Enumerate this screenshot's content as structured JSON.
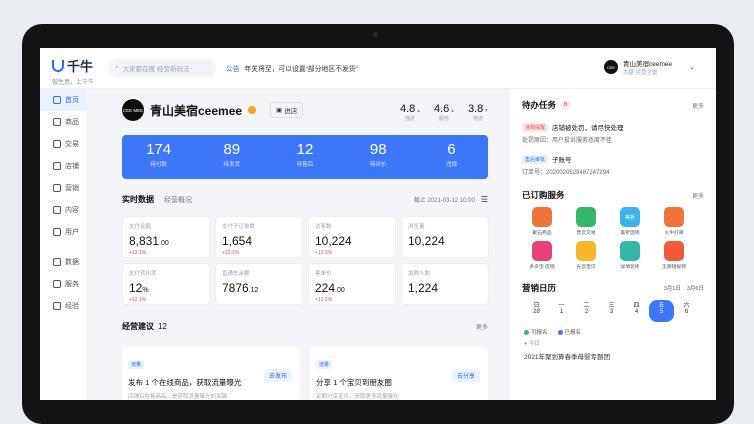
{
  "brand": {
    "name": "千牛",
    "slogan": "做生意，上千牛"
  },
  "search": {
    "placeholder": "大家都在搜  经营新玩法"
  },
  "notice": {
    "tag": "公告",
    "text": "年关将至，可以设置“部分地区不发货”"
  },
  "user": {
    "name": "青山美宿ceemee",
    "role": "大盘  运营主管",
    "avatar_text": "CEE"
  },
  "sidebar": {
    "items": [
      {
        "label": "首页",
        "active": true
      },
      {
        "label": "商品"
      },
      {
        "label": "交易"
      },
      {
        "label": "店铺"
      },
      {
        "label": "营销"
      },
      {
        "label": "内容"
      },
      {
        "label": "用户"
      },
      {
        "label": "数据"
      },
      {
        "label": "服务"
      },
      {
        "label": "经验"
      }
    ]
  },
  "shop": {
    "name": "青山美宿ceemee",
    "enter_label": "进店",
    "avatar_text": "CEE MEE"
  },
  "ratings": [
    {
      "value": "4.8",
      "label": "描述"
    },
    {
      "value": "4.6",
      "label": "服务"
    },
    {
      "value": "3.8",
      "label": "物流"
    }
  ],
  "banner": [
    {
      "value": "174",
      "label": "待付款"
    },
    {
      "value": "89",
      "label": "待发货"
    },
    {
      "value": "12",
      "label": "待售后"
    },
    {
      "value": "98",
      "label": "待评价"
    },
    {
      "value": "6",
      "label": "违规"
    }
  ],
  "realtime": {
    "title": "实时数据",
    "tab": "经营概况",
    "update": "截止 2021-03-12 10:00"
  },
  "cards": [
    {
      "label": "支付金额",
      "value": "8,831",
      "decimals": ".00",
      "change": "+12.1%"
    },
    {
      "label": "支付子订单数",
      "value": "1,654",
      "decimals": "",
      "change": "+12.1%"
    },
    {
      "label": "访客数",
      "value": "10,224",
      "decimals": "",
      "change": "+12.1%"
    },
    {
      "label": "浏览量",
      "value": "10,224",
      "decimals": "",
      "change": ""
    },
    {
      "label": "支付转化率",
      "value": "12",
      "decimals": "%",
      "change": "+12.1%"
    },
    {
      "label": "直通车余额",
      "value": "7876",
      "decimals": ".12",
      "change": ""
    },
    {
      "label": "客单价",
      "value": "224",
      "decimals": ".00",
      "change": "+12.1%"
    },
    {
      "label": "加购人数",
      "value": "1,224",
      "decimals": "",
      "change": ""
    }
  ],
  "suggestions": {
    "title": "经营建议",
    "count": "12",
    "more": "更多",
    "items": [
      {
        "tag": "流量",
        "text": "发布 1 个在线商品，获取流量曝光",
        "desc": "店铺有在售商品，是获取流量曝光的关键",
        "button": "去发布"
      },
      {
        "tag": "流量",
        "text": "分享 1 个宝贝到朋友圈",
        "desc": "定期分享宝贝，获取更多流量曝光",
        "button": "去分享"
      }
    ]
  },
  "tasks": {
    "title": "待办任务",
    "badge": "6",
    "more": "更多",
    "items": [
      {
        "tag": "违规提醒",
        "tag_color": "red",
        "title": "店铺被处罚，请尽快处理",
        "sub": "处罚原因：用户投诉服务态度不佳"
      },
      {
        "tag": "售后审批",
        "tag_color": "blue",
        "title": "子账号",
        "sub": "订单号：2020020529487247294"
      }
    ]
  },
  "services": {
    "title": "已订购服务",
    "more": "更多",
    "items": [
      {
        "label": "聚石商品",
        "color": "#f0733a"
      },
      {
        "label": "普云交易",
        "color": "#33b86b"
      },
      {
        "label": "美折促销",
        "color": "#3cb3e6",
        "text": "美折"
      },
      {
        "label": "火牛打单",
        "color": "#f0733a"
      },
      {
        "label": "多多宝 促销",
        "color": "#e8407a"
      },
      {
        "label": "光云宝贝",
        "color": "#f7b72d"
      },
      {
        "label": "详情装修",
        "color": "#33b8a6"
      },
      {
        "label": "王牌短视频",
        "color": "#f05a3a"
      }
    ]
  },
  "calendar": {
    "title": "营销日历",
    "range_start": "3月1日",
    "range_end": "3月6日",
    "days": [
      {
        "weekday": "日",
        "date": "28"
      },
      {
        "weekday": "一",
        "date": "1"
      },
      {
        "weekday": "二",
        "date": "2"
      },
      {
        "weekday": "三",
        "date": "3"
      },
      {
        "weekday": "四",
        "date": "4"
      },
      {
        "weekday": "五",
        "date": "5",
        "active": true
      },
      {
        "weekday": "六",
        "date": "6"
      }
    ],
    "legend": [
      {
        "label": "可报名",
        "color": "#33b86b"
      },
      {
        "label": "已报名",
        "color": "#3b77f6"
      }
    ],
    "today": "今日",
    "event": "2021年聚划算春季母婴专题团"
  }
}
